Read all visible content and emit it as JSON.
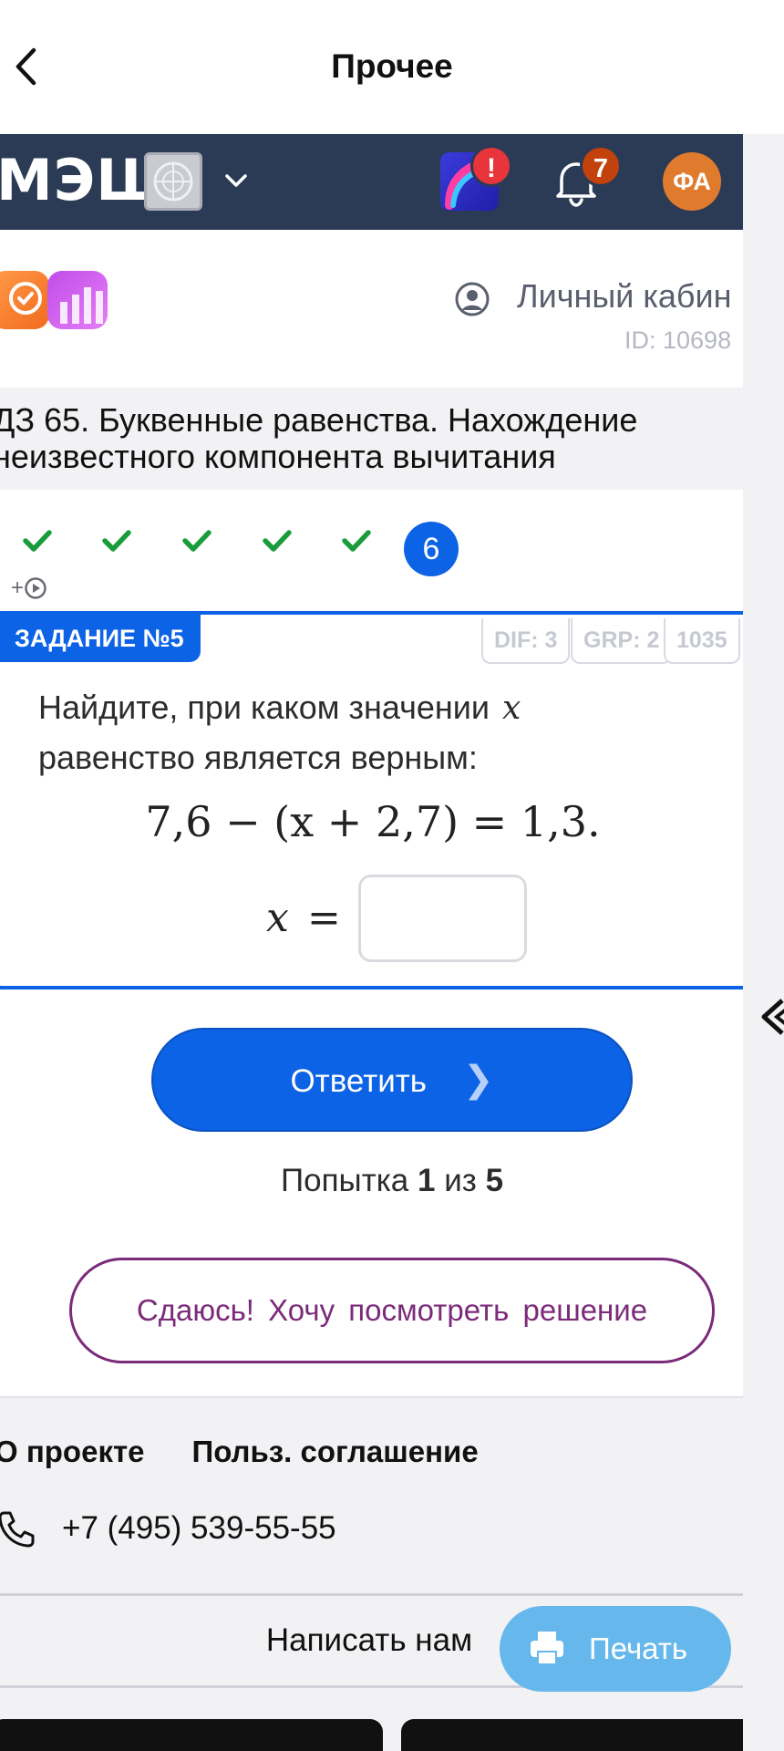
{
  "nav": {
    "title": "Прочее"
  },
  "mesh": {
    "logo": "МЭШ",
    "app_badge": "!",
    "notif_count": "7",
    "avatar_initials": "ФА"
  },
  "cabinet": {
    "label": "Личный кабин",
    "id": "ID: 10698"
  },
  "topic": {
    "line1": "ДЗ 65. Буквенные равенства. Нахождение",
    "line2": "неизвестного компонента вычитания"
  },
  "progress": {
    "completed_steps": 5,
    "active_step": "6",
    "plus_label": "+"
  },
  "task": {
    "label": "ЗАДАНИЕ №5",
    "meta": [
      "DIF: 3",
      "GRP: 2",
      "1035"
    ],
    "text_line1": "Найдите, при каком значении",
    "variable": "x",
    "text_line2": "равенство является верным:",
    "equation": "7,6 − (x + 2,7) = 1,3.",
    "answer_prefix_var": "x",
    "answer_prefix_eq": "=",
    "answer_value": ""
  },
  "actions": {
    "answer_label": "Ответить",
    "attempt_word": "Попытка",
    "attempt_current": "1",
    "attempt_of": "из",
    "attempt_total": "5",
    "giveup_label": "Сдаюсь! Хочу посмотреть решение"
  },
  "footer": {
    "about": "О проекте",
    "agreement": "Польз. соглашение",
    "phone": "+7 (495) 539-55-55",
    "write_us": "Написать нам"
  },
  "print": {
    "label": "Печать"
  },
  "colors": {
    "primary": "#0d63e6",
    "header_bg": "#2b3a55",
    "giveup": "#7a2b7a",
    "print": "#66b8ec",
    "check": "#1a9b3c"
  }
}
